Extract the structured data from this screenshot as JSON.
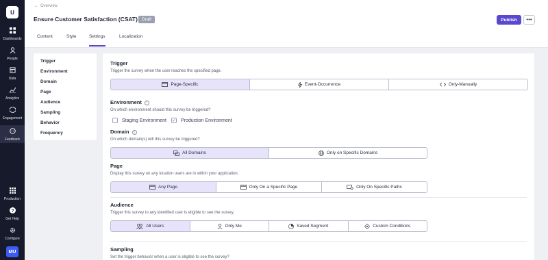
{
  "app": {
    "logo_text": "U"
  },
  "sidebar": {
    "items": [
      {
        "label": "Dashboards",
        "icon": "dashboard-icon"
      },
      {
        "label": "People",
        "icon": "people-icon"
      },
      {
        "label": "Data",
        "icon": "data-icon"
      },
      {
        "label": "Analytics",
        "icon": "analytics-icon"
      },
      {
        "label": "Engagement",
        "icon": "engagement-icon"
      },
      {
        "label": "Feedback",
        "icon": "feedback-icon"
      }
    ],
    "bottom": [
      {
        "label": "Production",
        "icon": "apps-grid-icon"
      },
      {
        "label": "Get Help",
        "icon": "help-icon"
      },
      {
        "label": "Configure",
        "icon": "gear-icon"
      }
    ],
    "avatar": "MU"
  },
  "header": {
    "back_label": "Overview",
    "title": "Ensure Customer Satisfaction (CSAT)",
    "status_badge": "Draft",
    "publish_label": "Publish",
    "more_label": "•••",
    "tabs": [
      "Content",
      "Style",
      "Settings",
      "Localization"
    ],
    "active_tab": "Settings"
  },
  "settings_nav": [
    "Trigger",
    "Environment",
    "Domain",
    "Page",
    "Audience",
    "Sampling",
    "Behavior",
    "Frequency"
  ],
  "trigger": {
    "title": "Trigger",
    "description": "Trigger the survey when the user reaches the specified page.",
    "options": [
      "Page-Specific",
      "Event-Occurrence",
      "Only-Manually"
    ],
    "selected": "Page-Specific"
  },
  "environment": {
    "title": "Environment",
    "description": "On which environment should this survey be triggered?",
    "options": [
      {
        "label": "Staging Environment",
        "checked": false
      },
      {
        "label": "Production Environment",
        "checked": true
      }
    ]
  },
  "domain": {
    "title": "Domain",
    "description": "On which domain(s) will this survey be triggered?",
    "options": [
      "All Domains",
      "Only on Specific Domains"
    ],
    "selected": "All Domains"
  },
  "page": {
    "title": "Page",
    "description": "Display this survey on any location users are in within your application.",
    "options": [
      "Any Page",
      "Only On a Specific Page",
      "Only On Specific Paths"
    ],
    "selected": "Any Page"
  },
  "audience": {
    "title": "Audience",
    "description": "Trigger this survey to any identified user is eligible to see the survey.",
    "options": [
      "All Users",
      "Only Me",
      "Saved Segment",
      "Custom Conditions"
    ],
    "selected": "All Users"
  },
  "sampling": {
    "title": "Sampling",
    "description": "Set the trigger behavior when a user is eligible to see the survey?"
  },
  "colors": {
    "accent": "#5a49cf",
    "rail": "#161a2b",
    "selected_option": "#e6e3fb"
  }
}
